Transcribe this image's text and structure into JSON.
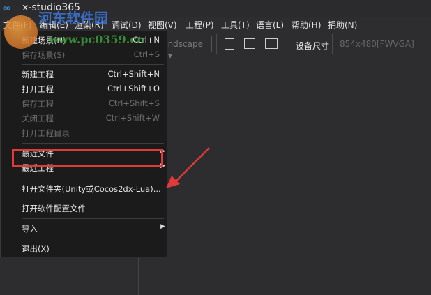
{
  "window": {
    "title": "x-studio365"
  },
  "menubar": [
    "文件(F)",
    "编辑(E)",
    "渲染(R)",
    "调试(D)",
    "视图(V)",
    "工程(P)",
    "工具(T)",
    "语言(L)",
    "帮助(H)",
    "捐助(N)"
  ],
  "toolbar": {
    "orientation": "Landscape",
    "device_label": "设备尺寸",
    "device_size": "854x480[FWVGA]",
    "icons": [
      "new-file-icon",
      "save-icon",
      "save-all-icon"
    ]
  },
  "file_menu": {
    "items": [
      {
        "label": "新建场景(N)",
        "shortcut": "Ctrl+N",
        "enabled": true
      },
      {
        "label": "保存场景(S)",
        "shortcut": "Ctrl+S",
        "enabled": false
      },
      {
        "label": "新建工程",
        "shortcut": "Ctrl+Shift+N",
        "enabled": true
      },
      {
        "label": "打开工程",
        "shortcut": "Ctrl+Shift+O",
        "enabled": true
      },
      {
        "label": "保存工程",
        "shortcut": "Ctrl+Shift+S",
        "enabled": false
      },
      {
        "label": "关闭工程",
        "shortcut": "Ctrl+Shift+W",
        "enabled": false
      },
      {
        "label": "打开工程目录",
        "shortcut": "",
        "enabled": false
      },
      {
        "label": "最近文件",
        "submenu": true,
        "enabled": true
      },
      {
        "label": "最近工程",
        "submenu": true,
        "enabled": true
      },
      {
        "label": "打开文件夹(Unity或Cocos2dx-Lua)...",
        "enabled": true,
        "highlighted": true
      },
      {
        "label": "打开软件配置文件",
        "enabled": true
      },
      {
        "label": "导入",
        "submenu": true,
        "enabled": true
      },
      {
        "label": "退出(X)",
        "enabled": true
      }
    ]
  },
  "annotation": {
    "color": "#e03a3a"
  },
  "watermark": {
    "text": "河东软件园",
    "url": "www.pc0359.cn"
  }
}
